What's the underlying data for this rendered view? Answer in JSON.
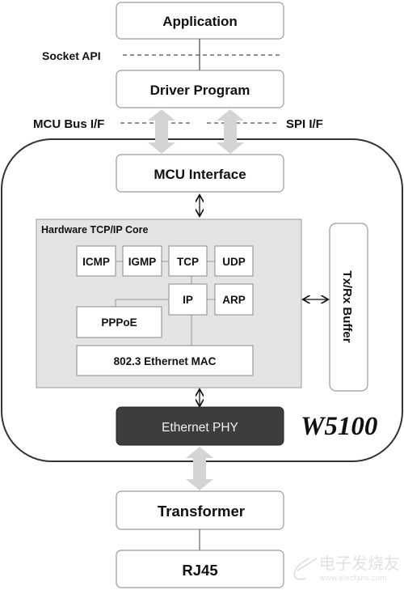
{
  "diagram": {
    "application": "Application",
    "socket_api": "Socket API",
    "driver_program": "Driver Program",
    "mcu_bus_if": "MCU Bus I/F",
    "spi_if": "SPI I/F",
    "mcu_interface": "MCU Interface",
    "core_title": "Hardware TCP/IP Core",
    "icmp": "ICMP",
    "igmp": "IGMP",
    "tcp": "TCP",
    "udp": "UDP",
    "ip": "IP",
    "arp": "ARP",
    "pppoe": "PPPoE",
    "mac": "802.3 Ethernet MAC",
    "buffer": "Tx/Rx Buffer",
    "phy": "Ethernet PHY",
    "chip": "W5100",
    "transformer": "Transformer",
    "rj45": "RJ45"
  },
  "watermark": {
    "logo_text": "电子发烧友",
    "url": "www.elecfans.com"
  },
  "colors": {
    "core_fill": "#e4e4e4",
    "phy_fill": "#3d3d3d",
    "arrow_gray": "#d4d4d4"
  }
}
